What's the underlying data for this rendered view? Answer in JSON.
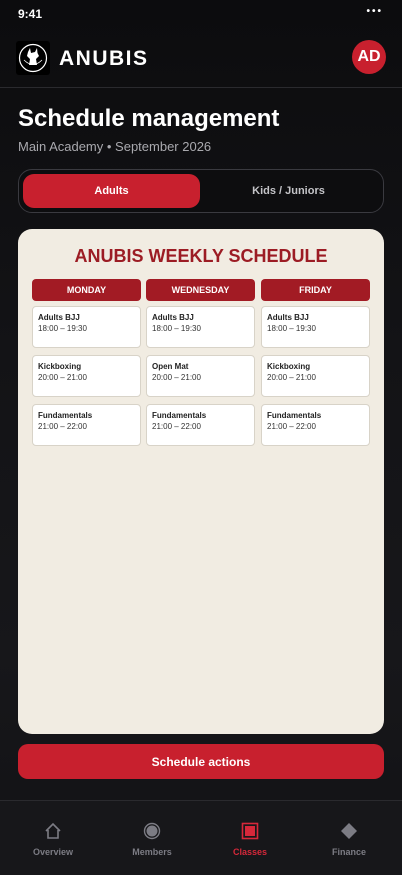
{
  "status_bar": {
    "time": "9:41",
    "menu": "•••"
  },
  "header": {
    "brand": "ANUBIS",
    "avatar_initials": "AD"
  },
  "page": {
    "title": "Schedule management",
    "subtitle": "Main Academy • September 2026"
  },
  "tabs": [
    {
      "label": "Adults",
      "active": true
    },
    {
      "label": "Kids / Juniors",
      "active": false
    }
  ],
  "schedule": {
    "title": "ANUBIS WEEKLY SCHEDULE",
    "days": [
      {
        "name": "MONDAY",
        "classes": [
          {
            "name": "Adults BJJ",
            "time": "18:00 – 19:30"
          },
          {
            "name": "Kickboxing",
            "time": "20:00 – 21:00"
          },
          {
            "name": "Fundamentals",
            "time": "21:00 – 22:00"
          }
        ]
      },
      {
        "name": "WEDNESDAY",
        "classes": [
          {
            "name": "Adults BJJ",
            "time": "18:00 – 19:30"
          },
          {
            "name": "Open Mat",
            "time": "20:00 – 21:00"
          },
          {
            "name": "Fundamentals",
            "time": "21:00 – 22:00"
          }
        ]
      },
      {
        "name": "FRIDAY",
        "classes": [
          {
            "name": "Adults BJJ",
            "time": "18:00 – 19:30"
          },
          {
            "name": "Kickboxing",
            "time": "20:00 – 21:00"
          },
          {
            "name": "Fundamentals",
            "time": "21:00 – 22:00"
          }
        ]
      }
    ]
  },
  "actions_button": "Schedule actions",
  "bottom_nav": [
    {
      "label": "Overview",
      "icon": "home-icon",
      "active": false
    },
    {
      "label": "Members",
      "icon": "members-icon",
      "active": false
    },
    {
      "label": "Classes",
      "icon": "classes-icon",
      "active": true
    },
    {
      "label": "Finance",
      "icon": "finance-icon",
      "active": false
    }
  ],
  "colors": {
    "accent": "#c8202e",
    "schedule_header": "#a21b24",
    "schedule_title": "#9c1c24",
    "card_bg": "#f1ece2",
    "nav_inactive": "#7c7c84"
  }
}
